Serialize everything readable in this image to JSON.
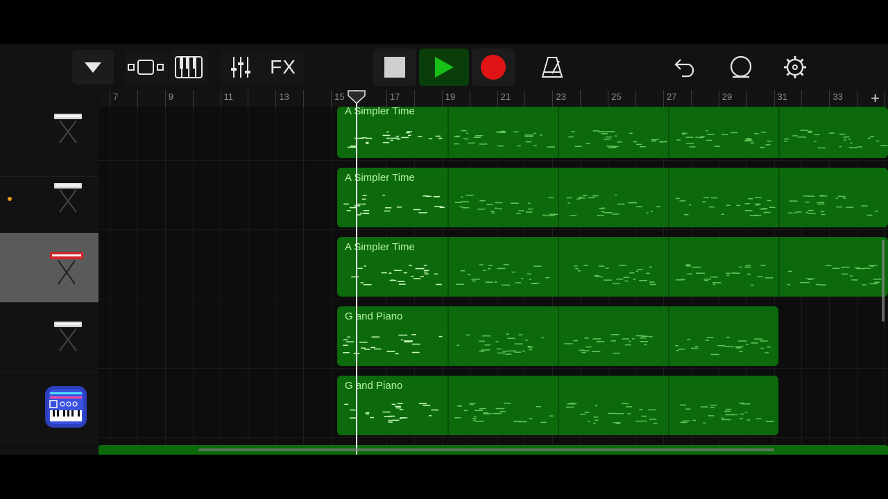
{
  "toolbar": {
    "fx_label": "FX",
    "icons": [
      "browser-dropdown-icon",
      "tracks-view-icon",
      "keyboard-icon",
      "mixer-icon",
      "stop-icon",
      "play-icon",
      "record-icon",
      "metronome-icon",
      "undo-icon",
      "loop-icon",
      "settings-icon"
    ]
  },
  "ruler": {
    "bars": [
      "7",
      "9",
      "11",
      "13",
      "15",
      "17",
      "19",
      "21",
      "23",
      "25",
      "27",
      "29",
      "31",
      "33"
    ],
    "add_label": "+"
  },
  "tracks": [
    {
      "instrument_icon": "keyboard-stand-icon",
      "selected": false
    },
    {
      "instrument_icon": "keyboard-stand-icon",
      "selected": false
    },
    {
      "instrument_icon": "red-keyboard-icon",
      "selected": true
    },
    {
      "instrument_icon": "keyboard-stand-icon",
      "selected": false
    },
    {
      "instrument_icon": "synth-app-icon",
      "selected": false
    }
  ],
  "regions": [
    {
      "name": "A Simpler Time"
    },
    {
      "name": "A Simpler Time"
    },
    {
      "name": "A Simpler Time"
    },
    {
      "name": "G and Piano"
    },
    {
      "name": "G and Piano"
    }
  ],
  "colors": {
    "region": "#0c6a0c",
    "region_text": "#b5f3a6",
    "play": "#16c016",
    "record": "#e01414",
    "selected_track": "#5a5a5a",
    "dot": "#e89b1a"
  }
}
